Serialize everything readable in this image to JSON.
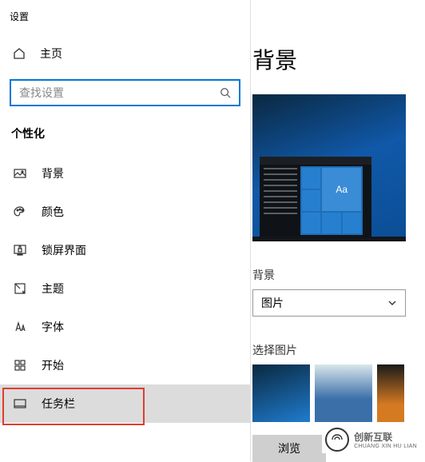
{
  "app_title": "设置",
  "home_label": "主页",
  "search": {
    "placeholder": "查找设置"
  },
  "section_header": "个性化",
  "nav": {
    "background": "背景",
    "colors": "颜色",
    "lockscreen": "锁屏界面",
    "themes": "主题",
    "fonts": "字体",
    "start": "开始",
    "taskbar": "任务栏"
  },
  "main": {
    "title": "背景",
    "preview_tile_text": "Aa",
    "bg_label": "背景",
    "bg_dropdown_value": "图片",
    "choose_label": "选择图片",
    "browse_label": "浏览"
  },
  "watermark": {
    "line1": "创新互联",
    "line2": "CHUANG XIN HU LIAN"
  }
}
